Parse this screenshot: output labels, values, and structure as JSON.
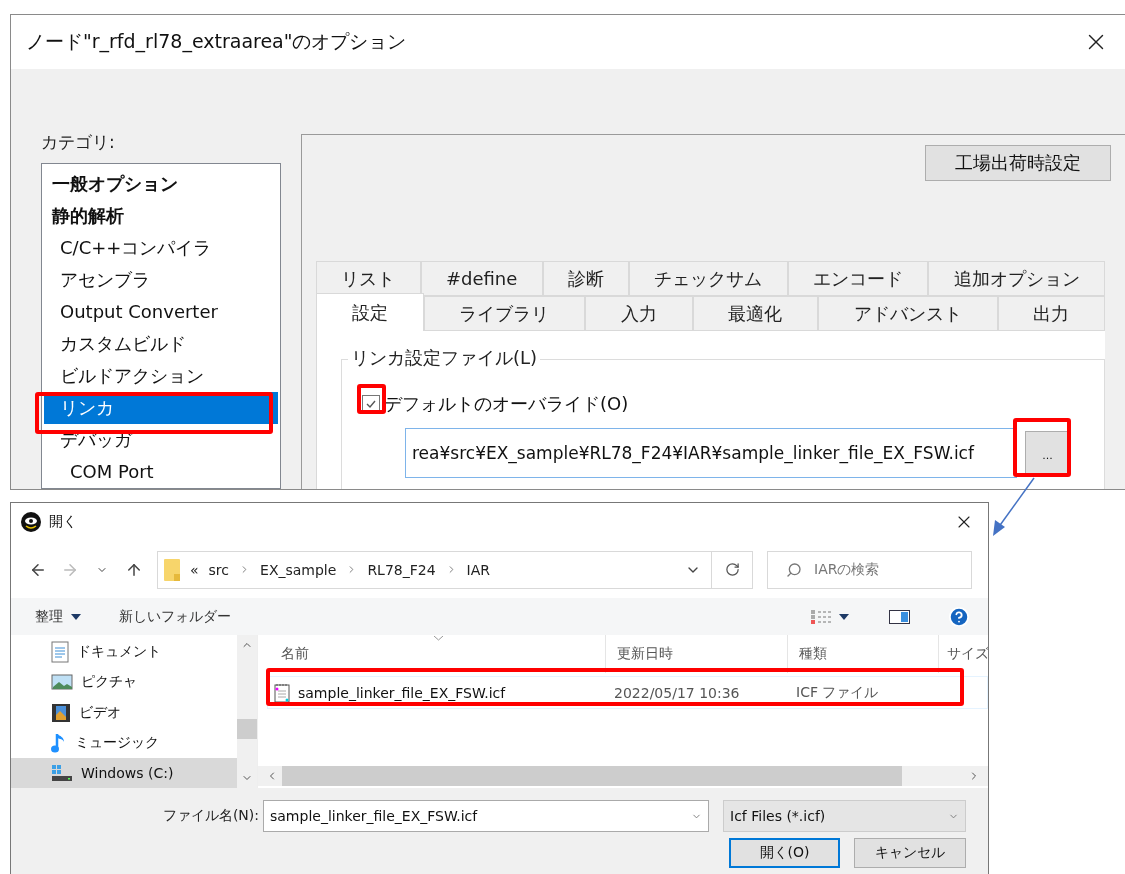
{
  "options_dialog": {
    "title": "ノード\"r_rfd_rl78_extraarea\"のオプション",
    "category_label": "カテゴリ:",
    "categories": [
      {
        "label": "一般オプション",
        "kind": "heading",
        "selected": false
      },
      {
        "label": "静的解析",
        "kind": "heading",
        "selected": false
      },
      {
        "label": "C/C++コンパイラ",
        "kind": "page",
        "selected": false
      },
      {
        "label": "アセンブラ",
        "kind": "page",
        "selected": false
      },
      {
        "label": "Output Converter",
        "kind": "page",
        "selected": false
      },
      {
        "label": "カスタムビルド",
        "kind": "page",
        "selected": false
      },
      {
        "label": "ビルドアクション",
        "kind": "page",
        "selected": false
      },
      {
        "label": "リンカ",
        "kind": "page",
        "selected": true
      },
      {
        "label": "デバッガ",
        "kind": "page",
        "selected": false,
        "children": [
          {
            "label": "COM Port",
            "kind": "page",
            "selected": false
          }
        ]
      }
    ],
    "factory_button": "工場出荷時設定",
    "tab_rows": [
      [
        {
          "label": "リスト",
          "selected": false
        },
        {
          "label": "#define",
          "selected": false
        },
        {
          "label": "診断",
          "selected": false
        },
        {
          "label": "チェックサム",
          "selected": false
        },
        {
          "label": "エンコード",
          "selected": false
        },
        {
          "label": "追加オプション",
          "selected": false
        }
      ],
      [
        {
          "label": "設定",
          "selected": true
        },
        {
          "label": "ライブラリ",
          "selected": false
        },
        {
          "label": "入力",
          "selected": false
        },
        {
          "label": "最適化",
          "selected": false
        },
        {
          "label": "アドバンスト",
          "selected": false
        },
        {
          "label": "出力",
          "selected": false
        }
      ]
    ],
    "group_title": "リンカ設定ファイル(L)",
    "override_checkbox": {
      "label": "デフォルトのオーバライド(O)",
      "checked": true
    },
    "path_field": {
      "value": "rea¥src¥EX_sample¥RL78_F24¥IAR¥sample_linker_file_EX_FSW.icf"
    },
    "browse_button": "..."
  },
  "open_dialog": {
    "title": "開く",
    "breadcrumb_overflow": "«",
    "breadcrumbs": [
      "src",
      "EX_sample",
      "RL78_F24",
      "IAR"
    ],
    "search": {
      "placeholder": "IARの検索"
    },
    "toolbar": {
      "organize": "整理",
      "new_folder": "新しいフォルダー"
    },
    "nav_items": [
      {
        "label": "ドキュメント",
        "kind": "documents",
        "selected": false
      },
      {
        "label": "ピクチャ",
        "kind": "pictures",
        "selected": false
      },
      {
        "label": "ビデオ",
        "kind": "videos",
        "selected": false
      },
      {
        "label": "ミュージック",
        "kind": "music",
        "selected": false
      },
      {
        "label": "Windows (C:)",
        "kind": "drive",
        "selected": true
      }
    ],
    "columns": [
      "名前",
      "更新日時",
      "種類",
      "サイズ"
    ],
    "rows": [
      {
        "name": "sample_linker_file_EX_FSW.icf",
        "modified": "2022/05/17 10:36",
        "type": "ICF ファイル",
        "selected": false
      }
    ],
    "filename_label": "ファイル名(N):",
    "filename_value": "sample_linker_file_EX_FSW.icf",
    "filter": "Icf Files (*.icf)",
    "buttons": [
      "開く(O)",
      "キャンセル"
    ]
  }
}
